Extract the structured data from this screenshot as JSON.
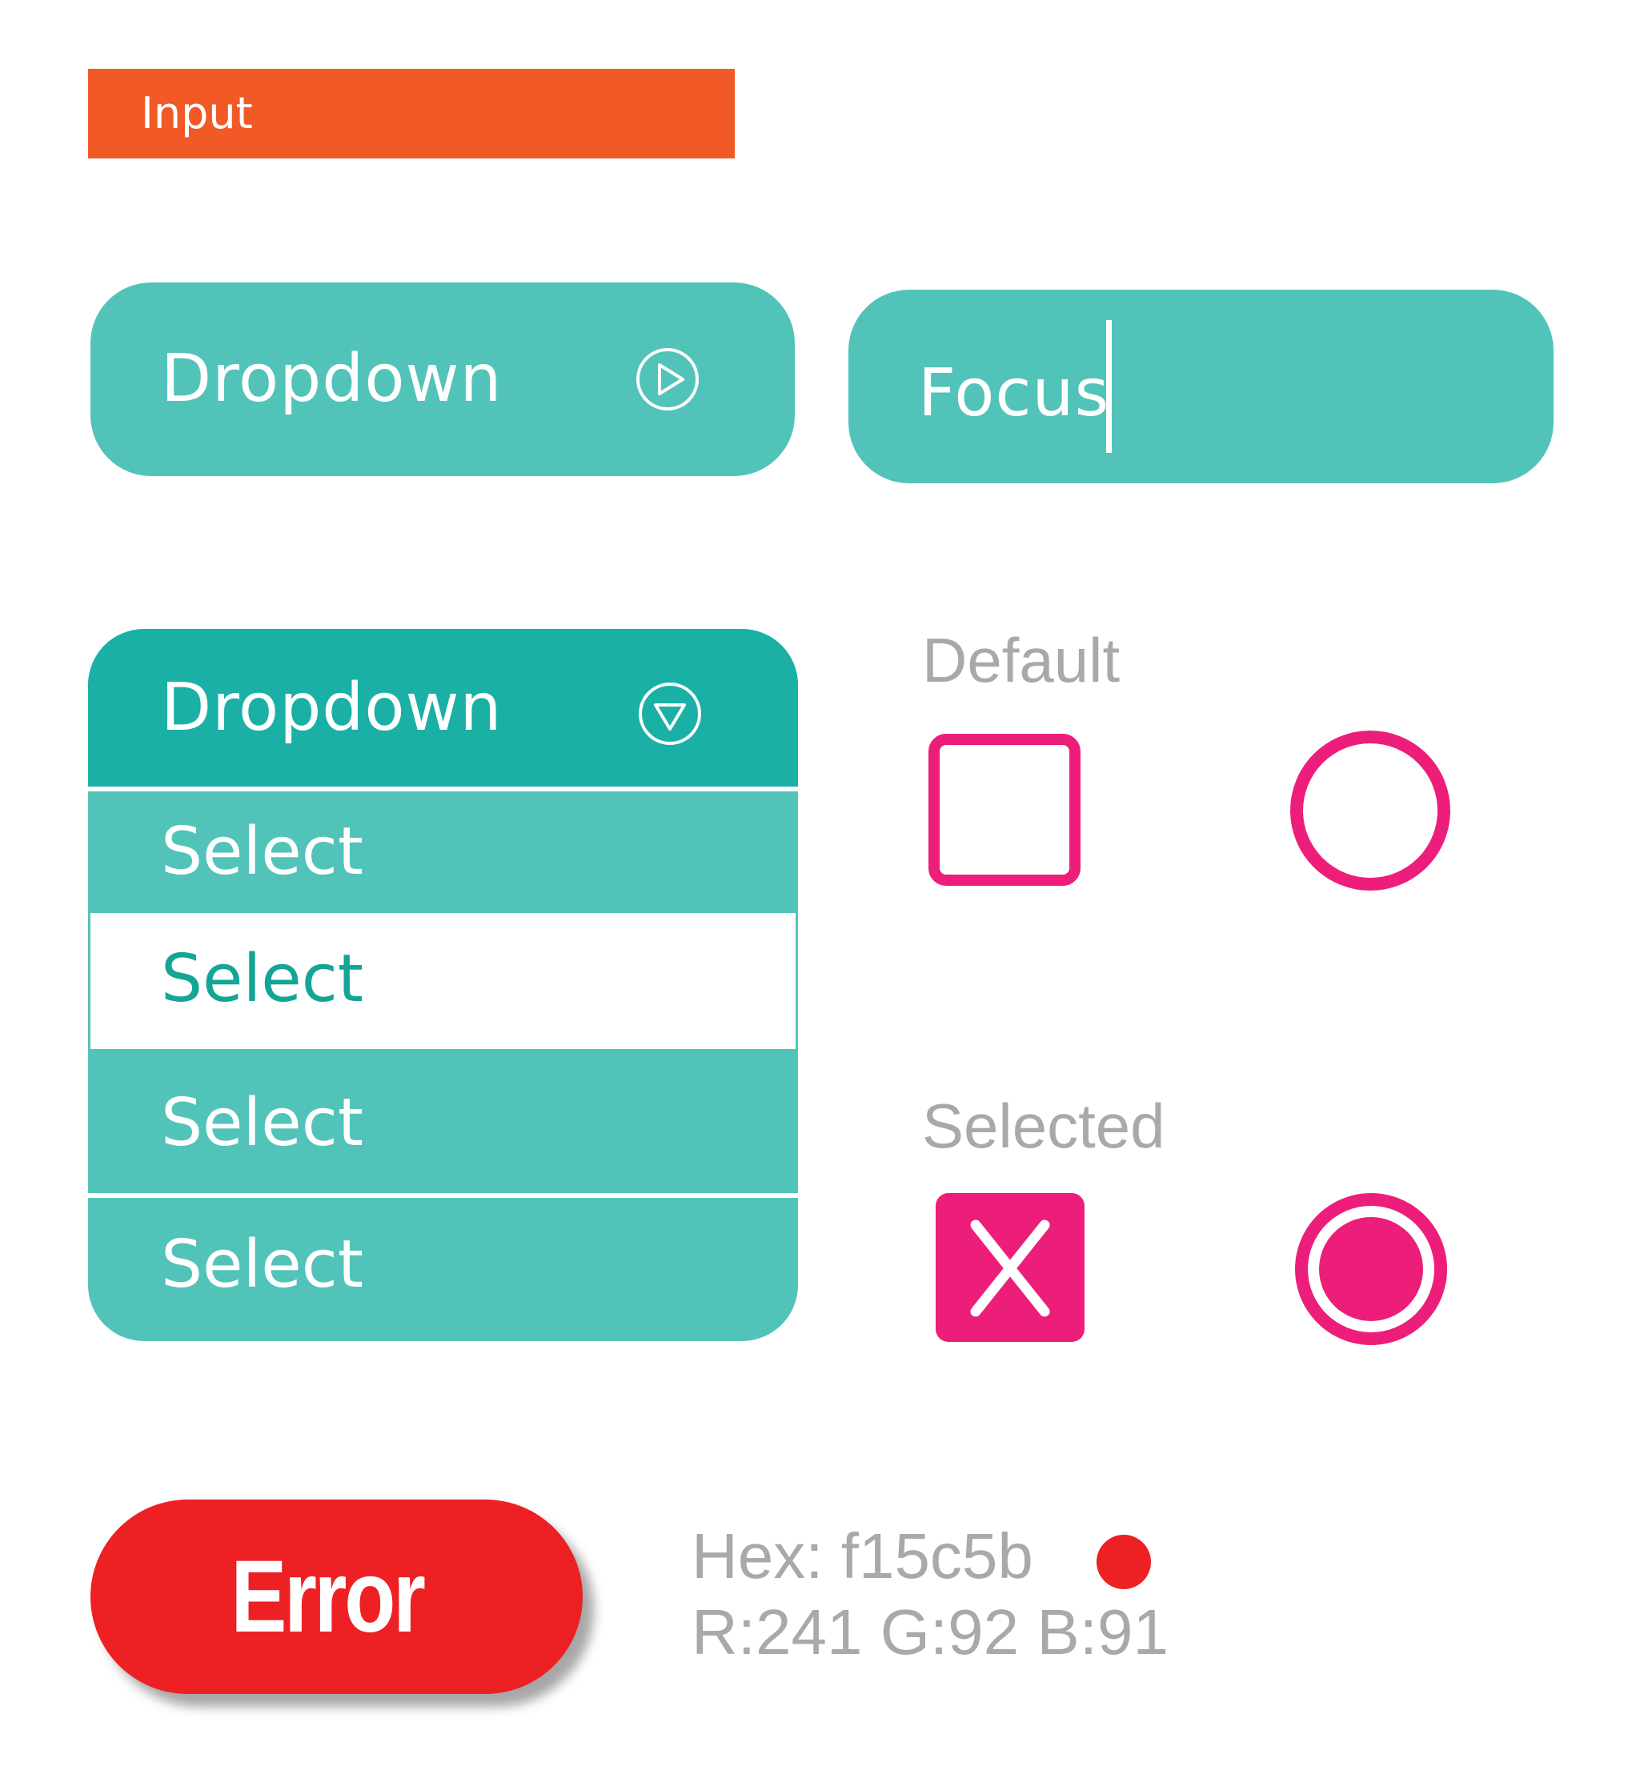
{
  "header": {
    "title": "Input",
    "color": "#f15a27"
  },
  "dropdown_collapsed": {
    "label": "Dropdown",
    "icon": "play-circle-icon"
  },
  "focus_input": {
    "value": "Focus",
    "state": "focused"
  },
  "dropdown_open": {
    "label": "Dropdown",
    "icon": "chevron-down-circle-icon",
    "options": [
      {
        "label": "Select",
        "highlighted": false
      },
      {
        "label": "Select",
        "highlighted": true
      },
      {
        "label": "Select",
        "highlighted": false
      },
      {
        "label": "Select",
        "highlighted": false
      }
    ]
  },
  "controls": {
    "default_label": "Default",
    "selected_label": "Selected",
    "checkbox_default_checked": false,
    "radio_default_checked": false,
    "checkbox_selected_checked": true,
    "radio_selected_checked": true,
    "accent_color": "#ed1e79"
  },
  "error": {
    "label": "Error",
    "color": "#ed2024"
  },
  "color_info": {
    "hex": "Hex: f15c5b",
    "rgb": "R:241 G:92 B:91"
  },
  "colors": {
    "teal": "#52c3b9",
    "teal_dark": "#1ab0a5",
    "gray_text": "#a7a9ac"
  }
}
